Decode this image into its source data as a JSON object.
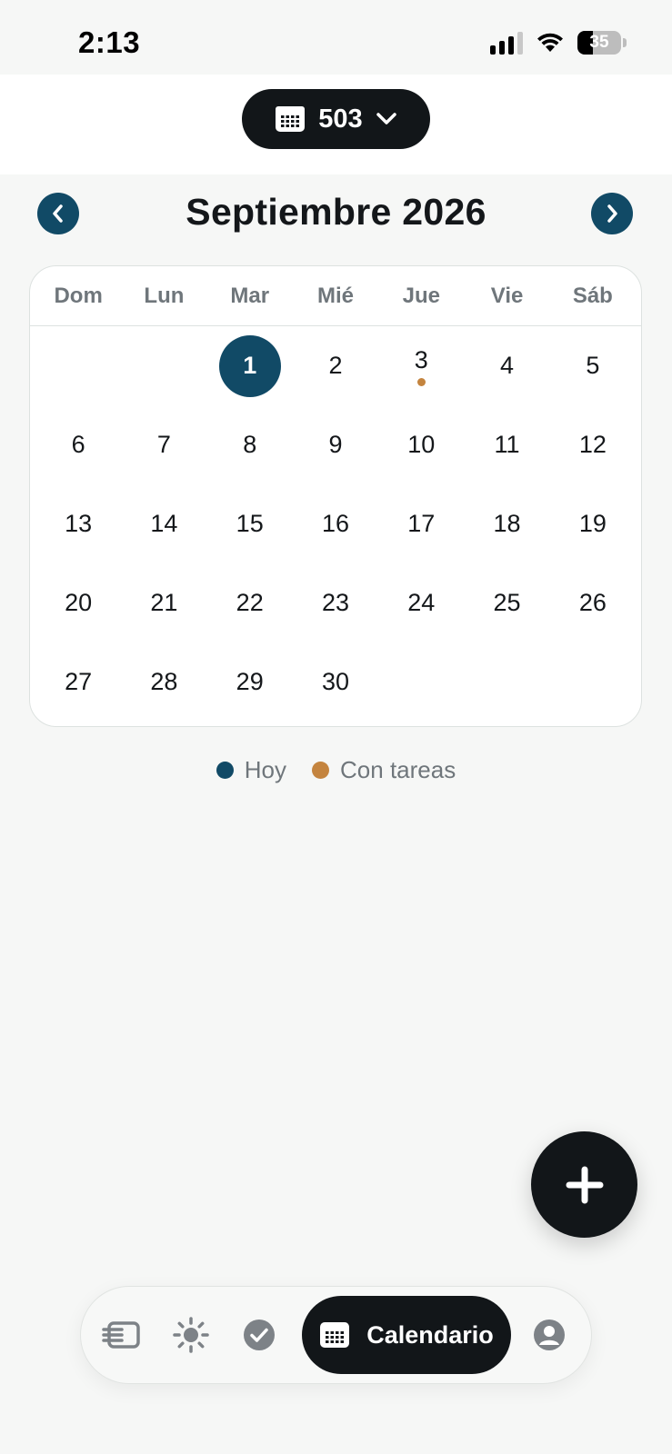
{
  "status_bar": {
    "time": "2:13",
    "battery": "35",
    "battery_level": 0.35,
    "icons": [
      "cellular-signal-icon",
      "wifi-icon",
      "battery-icon"
    ]
  },
  "header": {
    "selector_value": "503",
    "selector_icon": "calendar-icon",
    "dropdown_icon": "chevron-down-icon"
  },
  "calendar": {
    "month_title": "Septiembre 2026",
    "prev_icon": "chevron-left-icon",
    "next_icon": "chevron-right-icon",
    "weekdays": [
      "Dom",
      "Lun",
      "Mar",
      "Mié",
      "Jue",
      "Vie",
      "Sáb"
    ],
    "days": [
      "",
      "",
      "1",
      "2",
      "3",
      "4",
      "5",
      "6",
      "7",
      "8",
      "9",
      "10",
      "11",
      "12",
      "13",
      "14",
      "15",
      "16",
      "17",
      "18",
      "19",
      "20",
      "21",
      "22",
      "23",
      "24",
      "25",
      "26",
      "27",
      "28",
      "29",
      "30",
      "",
      "",
      ""
    ],
    "today": "1",
    "days_with_tasks": [
      "3"
    ]
  },
  "legend": {
    "today_label": "Hoy",
    "tasks_label": "Con tareas"
  },
  "colors": {
    "today": "#114a66",
    "task": "#c4843f",
    "dark": "#121619",
    "muted": "#6f767b",
    "background": "#f6f7f6"
  },
  "fab": {
    "icon": "plus-icon"
  },
  "bottom_nav": {
    "items": [
      {
        "icon": "cards-icon"
      },
      {
        "icon": "sun-icon"
      },
      {
        "icon": "check-circle-icon"
      },
      {
        "icon": "calendar-icon",
        "label": "Calendario",
        "active": true
      },
      {
        "icon": "profile-icon"
      }
    ],
    "active_label": "Calendario"
  }
}
